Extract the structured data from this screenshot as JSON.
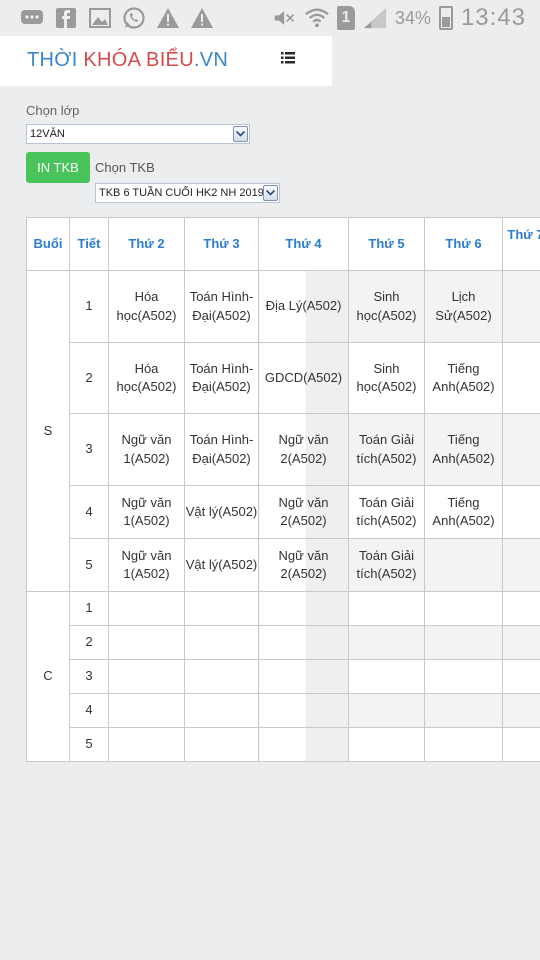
{
  "status_bar": {
    "battery": "34%",
    "time": "13:43",
    "sim": "1",
    "left_icons": [
      "chat-bubble-icon",
      "facebook-icon",
      "image-icon",
      "whatsapp-icon",
      "warning-icon",
      "warning-icon"
    ]
  },
  "header": {
    "logo_part1": "THỜI ",
    "logo_part2": "KHÓA BIỂU",
    "logo_part3": ".VN",
    "menu_icon": "list-menu-icon",
    "logo_colors": {
      "blue": "#3a86c8",
      "red": "#d64a4a"
    }
  },
  "controls": {
    "class_label": "Chọn lớp",
    "class_value": "12VĂN",
    "print_button": "IN TKB",
    "tkb_label": "Chọn TKB",
    "tkb_value": "TKB 6 TUẦN CUỐI HK2 NH 2019-",
    "print_button_color": "#48c45b"
  },
  "timetable": {
    "headers": [
      "Buổi",
      "Tiết",
      "Thứ 2",
      "Thứ 3",
      "Thứ 4",
      "Thứ 5",
      "Thứ 6",
      "Thứ 7"
    ],
    "sessions": [
      "S",
      "C"
    ],
    "morning": [
      {
        "tiet": "1",
        "cells": [
          "Hóa học(A502)",
          "Toán Hình-Đại(A502)",
          "Địa Lý(A502)",
          "Sinh học(A502)",
          "Lịch Sử(A502)",
          ""
        ]
      },
      {
        "tiet": "2",
        "cells": [
          "Hóa học(A502)",
          "Toán Hình-Đại(A502)",
          "GDCD(A502)",
          "Sinh học(A502)",
          "Tiếng Anh(A502)",
          ""
        ]
      },
      {
        "tiet": "3",
        "cells": [
          "Ngữ văn 1(A502)",
          "Toán Hình-Đại(A502)",
          "Ngữ văn 2(A502)",
          "Toán Giải tích(A502)",
          "Tiếng Anh(A502)",
          ""
        ]
      },
      {
        "tiet": "4",
        "cells": [
          "Ngữ văn 1(A502)",
          "Vật lý(A502)",
          "Ngữ văn 2(A502)",
          "Toán Giải tích(A502)",
          "Tiếng Anh(A502)",
          ""
        ]
      },
      {
        "tiet": "5",
        "cells": [
          "Ngữ văn 1(A502)",
          "Vật lý(A502)",
          "Ngữ văn 2(A502)",
          "Toán Giải tích(A502)",
          "",
          ""
        ]
      }
    ],
    "afternoon": [
      {
        "tiet": "1"
      },
      {
        "tiet": "2"
      },
      {
        "tiet": "3"
      },
      {
        "tiet": "4"
      },
      {
        "tiet": "5"
      }
    ],
    "header_color": "#2b7cd3"
  }
}
